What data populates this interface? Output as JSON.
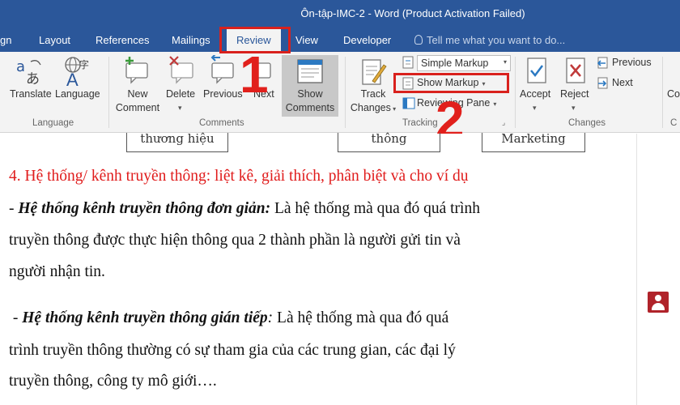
{
  "window": {
    "title": "Ôn-tập-IMC-2 - Word (Product Activation Failed)"
  },
  "tabs": [
    {
      "label": "gn"
    },
    {
      "label": "Layout"
    },
    {
      "label": "References"
    },
    {
      "label": "Mailings"
    },
    {
      "label": "Review"
    },
    {
      "label": "View"
    },
    {
      "label": "Developer"
    }
  ],
  "tell_me": {
    "placeholder": "Tell me what you want to do..."
  },
  "ribbon": {
    "language_group": {
      "label": "Language",
      "translate": "Translate",
      "language": "Language"
    },
    "comments_group": {
      "label": "Comments",
      "new_comment": [
        "New",
        "Comment"
      ],
      "delete": "Delete",
      "previous": "Previous",
      "next": "Next",
      "show_comments": [
        "Show",
        "Comments"
      ]
    },
    "tracking_group": {
      "label": "Tracking",
      "track_changes": [
        "Track",
        "Changes"
      ],
      "simple_markup": "Simple Markup",
      "show_markup": "Show Markup",
      "reviewing_pane": "Reviewing Pane"
    },
    "changes_group": {
      "label": "Changes",
      "accept": "Accept",
      "reject": "Reject",
      "previous": "Previous",
      "next": "Next"
    },
    "edge": {
      "label_top": "Co",
      "label_bottom": "C"
    }
  },
  "annotations": {
    "step1": "1",
    "step2": "2"
  },
  "document": {
    "boxes": [
      "thương hiệu",
      "thông",
      "Marketing"
    ],
    "heading": "4. Hệ thống/ kênh truyền thông: liệt kê, giải thích, phân biệt và cho ví dụ",
    "para1": {
      "prefix": "- ",
      "term": "Hệ thống kênh truyền thông đơn giản:",
      "text": " Là hệ thống mà qua đó quá trình",
      "line2": "truyền thông được thực hiện thông qua 2 thành phần là người gửi tin và",
      "line3": "người nhận tin."
    },
    "para2": {
      "prefix": " - ",
      "term": "Hệ thống kênh truyền thông gián tiếp",
      "colon": ":",
      "text": " Là hệ thống mà qua đó quá",
      "line2": "trình truyền thông thường có sự tham gia của các trung gian, các đại lý",
      "line3": "truyền thông, công ty mô giới…."
    }
  },
  "colors": {
    "accent": "#2b579a",
    "highlight": "#e1201c",
    "heading": "#e01b1b"
  }
}
